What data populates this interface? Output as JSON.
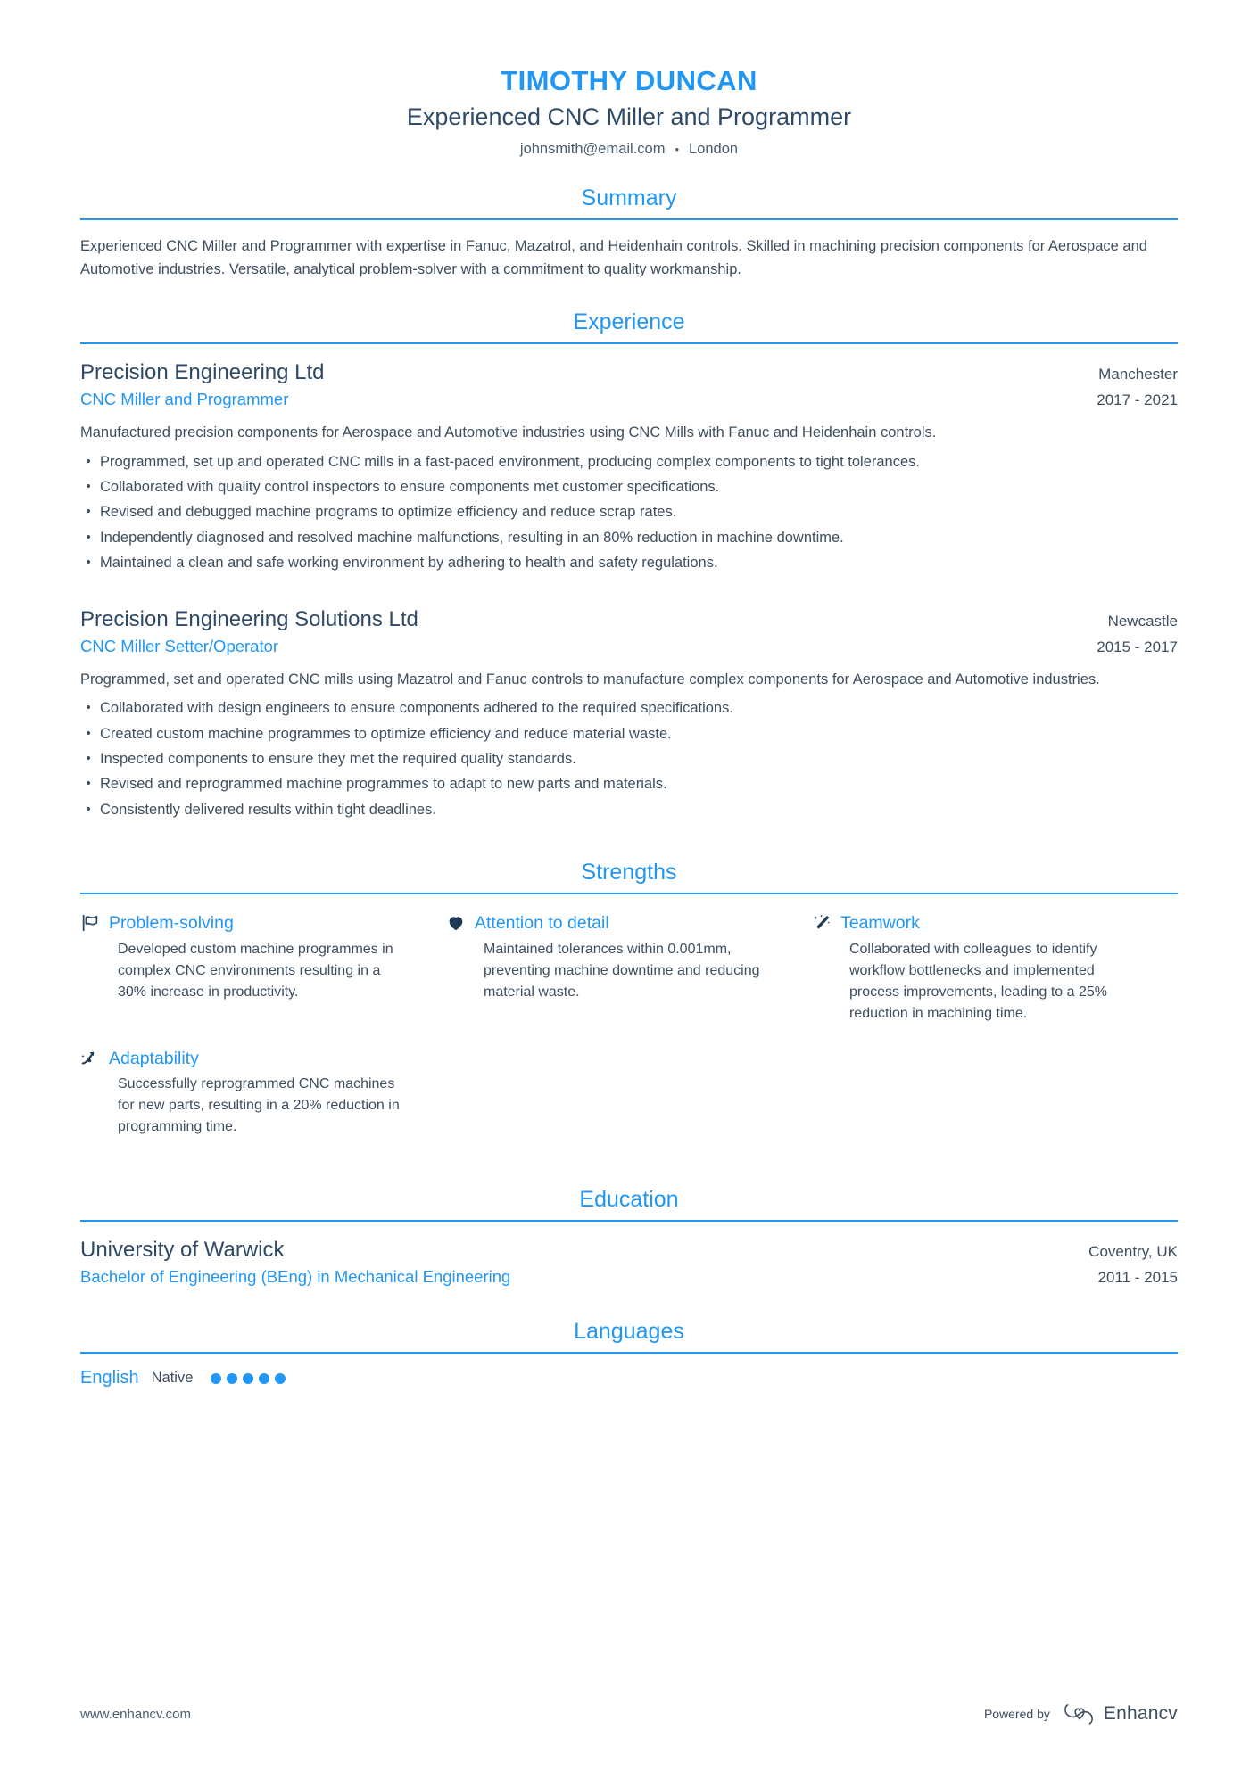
{
  "colors": {
    "accent": "#2196f3",
    "heading_dark": "#2e4a66",
    "body_text": "#3e4e5e"
  },
  "header": {
    "name": "TIMOTHY DUNCAN",
    "title": "Experienced CNC Miller and Programmer",
    "email": "johnsmith@email.com",
    "separator": "•",
    "location": "London"
  },
  "sections": {
    "summary": {
      "title": "Summary",
      "text": "Experienced CNC Miller and Programmer with expertise in Fanuc, Mazatrol, and Heidenhain controls. Skilled in machining precision components for Aerospace and Automotive industries. Versatile, analytical problem-solver with a commitment to quality workmanship."
    },
    "experience": {
      "title": "Experience",
      "entries": [
        {
          "organization": "Precision Engineering Ltd",
          "role": "CNC Miller and Programmer",
          "location": "Manchester",
          "dates": "2017 - 2021",
          "description": "Manufactured precision components for Aerospace and Automotive industries using CNC Mills with Fanuc and Heidenhain controls.",
          "bullets": [
            "Programmed, set up and operated CNC mills in a fast-paced environment, producing complex components to tight tolerances.",
            "Collaborated with quality control inspectors to ensure components met customer specifications.",
            "Revised and debugged machine programs to optimize efficiency and reduce scrap rates.",
            "Independently diagnosed and resolved machine malfunctions, resulting in an 80% reduction in machine downtime.",
            "Maintained a clean and safe working environment by adhering to health and safety regulations."
          ]
        },
        {
          "organization": "Precision Engineering Solutions Ltd",
          "role": "CNC Miller Setter/Operator",
          "location": "Newcastle",
          "dates": "2015 - 2017",
          "description": "Programmed, set and operated CNC mills using Mazatrol and Fanuc controls to manufacture complex components for Aerospace and Automotive industries.",
          "bullets": [
            "Collaborated with design engineers to ensure components adhered to the required specifications.",
            "Created custom machine programmes to optimize efficiency and reduce material waste.",
            "Inspected components to ensure they met the required quality standards.",
            "Revised and reprogrammed machine programmes to adapt to new parts and materials.",
            "Consistently delivered results within tight deadlines."
          ]
        }
      ]
    },
    "strengths": {
      "title": "Strengths",
      "items": [
        {
          "icon": "flag-icon",
          "name": "Problem-solving",
          "description": "Developed custom machine programmes in complex CNC environments resulting in a 30% increase in productivity."
        },
        {
          "icon": "heart-icon",
          "name": "Attention to detail",
          "description": "Maintained tolerances within 0.001mm, preventing machine downtime and reducing material waste."
        },
        {
          "icon": "magic-wand-icon",
          "name": "Teamwork",
          "description": "Collaborated with colleagues to identify workflow bottlenecks and implemented process improvements, leading to a 25% reduction in machining time."
        },
        {
          "icon": "trending-arrow-icon",
          "name": "Adaptability",
          "description": "Successfully reprogrammed CNC machines for new parts, resulting in a 20% reduction in programming time."
        }
      ]
    },
    "education": {
      "title": "Education",
      "entries": [
        {
          "organization": "University of Warwick",
          "degree": "Bachelor of Engineering (BEng) in Mechanical Engineering",
          "location": "Coventry, UK",
          "dates": "2011 - 2015"
        }
      ]
    },
    "languages": {
      "title": "Languages",
      "items": [
        {
          "name": "English",
          "level": "Native",
          "rating": 5,
          "rating_max": 5
        }
      ]
    }
  },
  "footer": {
    "url": "www.enhancv.com",
    "powered_by": "Powered by",
    "brand": "Enhancv"
  }
}
